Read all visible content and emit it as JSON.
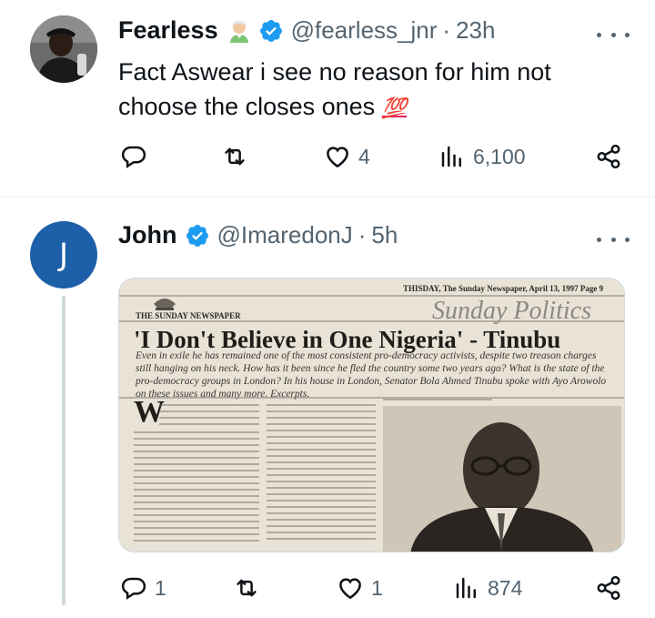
{
  "tweets": [
    {
      "name": "Fearless",
      "badge_emoji": "person-white-hair-emoji",
      "verified": true,
      "handle": "@fearless_jnr",
      "separator": "·",
      "time": "23h",
      "text": "Fact Aswear i see no reason for him not choose the closes ones",
      "text_emoji": "💯",
      "actions": {
        "reply_count": "",
        "retweet_count": "",
        "like_count": "4",
        "views_count": "6,100"
      }
    },
    {
      "name": "John",
      "avatar_initial": "J",
      "verified": true,
      "handle": "@ImaredonJ",
      "separator": "·",
      "time": "5h",
      "media": {
        "dateline": "THISDAY, The Sunday Newspaper, April 13, 1997 Page 9",
        "section": "Sunday Politics",
        "masthead": "THE SUNDAY NEWSPAPER",
        "headline": "'I Don't Believe in One Nigeria' - Tinubu",
        "intro": "Even in exile he has remained one of the most consistent pro-democracy activists, despite two treason charges still hanging on his neck. How has it been since he fled the country some two years ago? What is the state of the pro-democracy groups in London? In his house in London, Senator Bola Ahmed Tinubu spoke with Ayo Arowolo on these issues and many more. Excerpts.",
        "dropcap": "W"
      },
      "actions": {
        "reply_count": "1",
        "retweet_count": "",
        "like_count": "1",
        "views_count": "874"
      }
    }
  ],
  "colors": {
    "verified": "#1d9bf0",
    "secondary_text": "#536471",
    "avatar_john": "#1d5fa8",
    "hundred_emoji": "#e0245e"
  }
}
